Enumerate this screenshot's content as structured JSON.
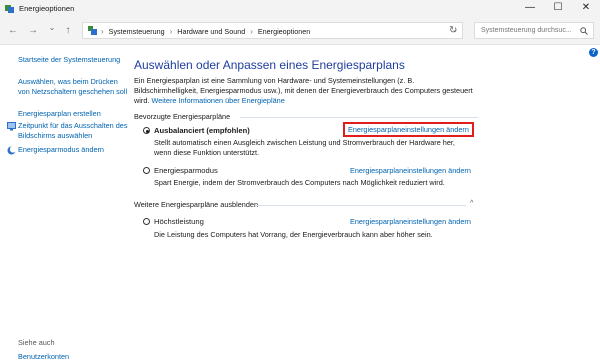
{
  "window": {
    "title": "Energieoptionen"
  },
  "titlebar": {
    "minimize": "—",
    "maximize": "☐",
    "close": "✕"
  },
  "nav": {
    "back": "←",
    "forward": "→",
    "dropdown": "⌄",
    "up": "↑",
    "refresh": "↻"
  },
  "breadcrumbs": [
    "Systemsteuerung",
    "Hardware und Sound",
    "Energieoptionen"
  ],
  "breadcrumb_sep": "›",
  "search": {
    "placeholder": "Systemsteuerung durchsuc...",
    "icon": "search-icon"
  },
  "sidebar": {
    "links": [
      {
        "label": "Startseite der Systemsteuerung"
      },
      {
        "label": "Auswählen, was beim Drücken von Netzschaltern geschehen soll"
      },
      {
        "label": "Energiesparplan erstellen"
      },
      {
        "label": "Zeitpunkt für das Ausschalten des Bildschirms auswählen"
      },
      {
        "label": "Energiesparmodus ändern"
      }
    ],
    "see_also": "Siehe auch",
    "user_accounts": "Benutzerkonten"
  },
  "main": {
    "heading": "Auswählen oder Anpassen eines Energiesparplans",
    "intro_text": "Ein Energiesparplan ist eine Sammlung von Hardware- und Systemeinstellungen (z. B. Bildschirmhelligkeit, Energiesparmodus usw.), mit denen der Energieverbrauch des Computers gesteuert wird.",
    "intro_link": "Weitere Informationen über Energiepläne",
    "preferred_label": "Bevorzugte Energiesparpläne",
    "more_label": "Weitere Energiesparpläne ausblenden",
    "collapse_icon": "^",
    "plans": [
      {
        "name": "Ausbalanciert (empfohlen)",
        "selected": true,
        "desc": "Stellt automatisch einen Ausgleich zwischen Leistung und Stromverbrauch der Hardware her, wenn diese Funktion unterstützt.",
        "link": "Energiesparplaneinstellungen ändern"
      },
      {
        "name": "Energiesparmodus",
        "selected": false,
        "desc": "Spart Energie, indem der Stromverbrauch des Computers nach Möglichkeit reduziert wird.",
        "link": "Energiesparplaneinstellungen ändern"
      },
      {
        "name": "Höchstleistung",
        "selected": false,
        "desc": "Die Leistung des Computers hat Vorrang, der Energieverbrauch kann aber höher sein.",
        "link": "Energiesparplaneinstellungen ändern"
      }
    ]
  },
  "help": "?",
  "colors": {
    "heading": "#1f3f9e",
    "link": "#0063b1",
    "highlight": "#e01e1e",
    "help": "#0a64c8"
  }
}
